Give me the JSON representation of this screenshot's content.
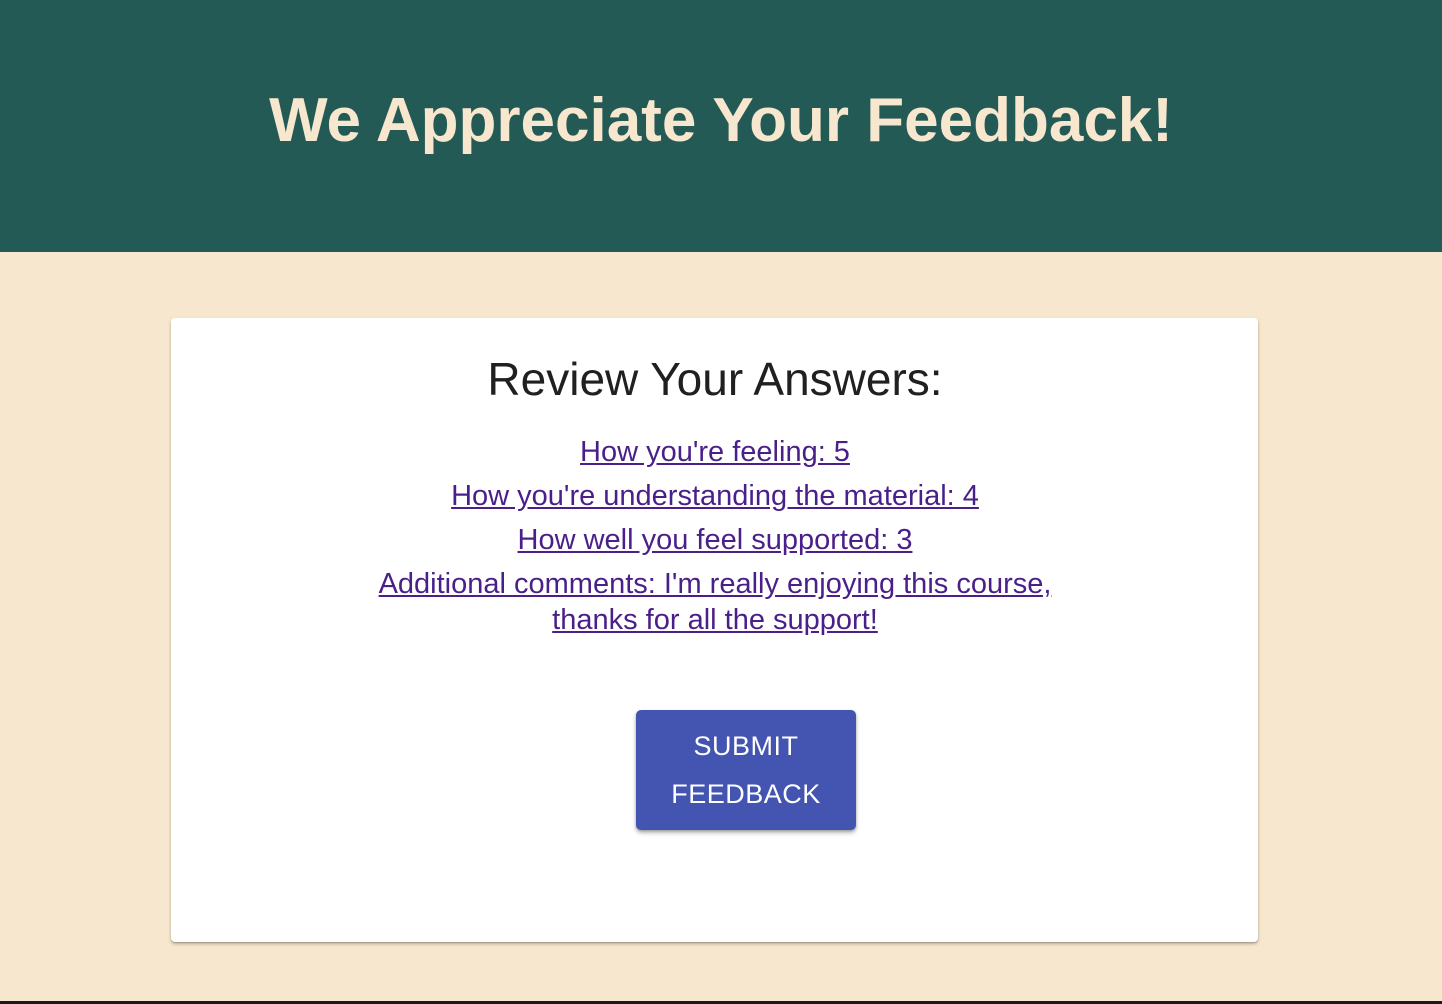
{
  "header": {
    "title": "We Appreciate Your Feedback!"
  },
  "review": {
    "title": "Review Your Answers:",
    "answers": [
      "How you're feeling: 5",
      "How you're understanding the material: 4",
      "How well you feel supported: 3",
      "Additional comments: I'm really enjoying this course, thanks for all the support!"
    ]
  },
  "actions": {
    "submit_label": "Submit Feedback"
  },
  "colors": {
    "header_bg": "#245a56",
    "page_bg": "#f7e7ce",
    "header_text": "#f7e7ce",
    "link": "#4a1f8a",
    "button_bg": "#4355b0"
  }
}
